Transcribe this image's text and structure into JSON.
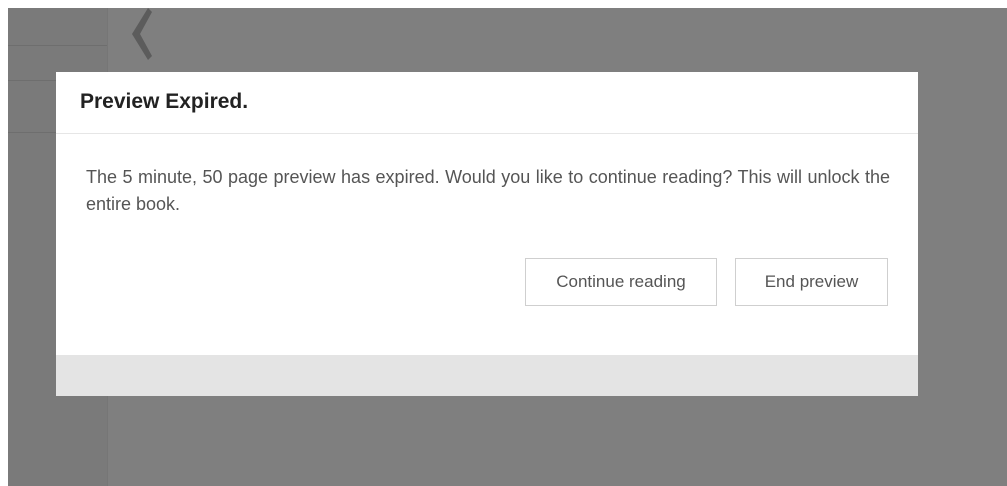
{
  "background": {
    "overlay_color": "#7f7f7f",
    "back_icon": "chevron-left-icon"
  },
  "modal": {
    "title": "Preview Expired.",
    "message": "The 5 minute, 50 page preview has expired. Would you like to continue reading? This will unlock the entire book.",
    "buttons": {
      "continue_label": "Continue reading",
      "end_label": "End preview"
    }
  }
}
